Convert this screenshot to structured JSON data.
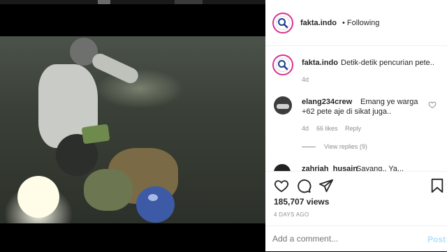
{
  "post": {
    "username": "fakta.indo",
    "follow_status": "• Following",
    "caption_user": "fakta.indo",
    "caption_text": "Detik-detik pencurian pete..",
    "caption_age": "4d",
    "views": "185,707 views",
    "date": "4 DAYS AGO"
  },
  "comments": [
    {
      "username": "elang234crew",
      "text_line1": "Emang ye warga",
      "text_line2": "+62 pete aje di sikat juga..",
      "age": "4d",
      "likes": "66 likes",
      "reply_label": "Reply",
      "view_replies": "View replies (9)"
    },
    {
      "username": "zahriah_husain",
      "text": "Sayang.. Ya..."
    }
  ],
  "comment_box": {
    "placeholder": "Add a comment...",
    "post_label": "Post"
  },
  "icons": {
    "heart": "heart-icon",
    "comment": "comment-icon",
    "share": "share-icon",
    "save": "bookmark-icon",
    "like_comment": "small-heart-icon"
  },
  "colors": {
    "avatar_ring": "#d7338f",
    "link_disabled": "#b2dffc",
    "muted": "#8e8e8e"
  }
}
